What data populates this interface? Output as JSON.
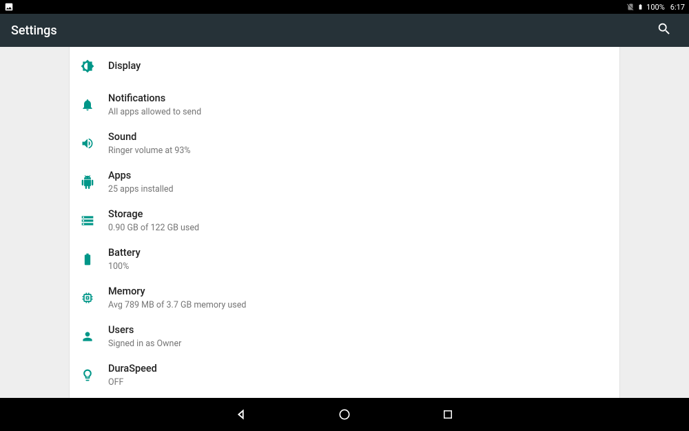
{
  "status": {
    "battery_text": "100%",
    "clock": "6:17"
  },
  "header": {
    "title": "Settings"
  },
  "items": [
    {
      "icon": "display",
      "title": "Display",
      "sub": null
    },
    {
      "icon": "notifications",
      "title": "Notifications",
      "sub": "All apps allowed to send"
    },
    {
      "icon": "sound",
      "title": "Sound",
      "sub": "Ringer volume at 93%"
    },
    {
      "icon": "apps",
      "title": "Apps",
      "sub": "25 apps installed"
    },
    {
      "icon": "storage",
      "title": "Storage",
      "sub": "0.90 GB of 122 GB used"
    },
    {
      "icon": "battery",
      "title": "Battery",
      "sub": "100%"
    },
    {
      "icon": "memory",
      "title": "Memory",
      "sub": "Avg 789 MB of 3.7 GB memory used"
    },
    {
      "icon": "users",
      "title": "Users",
      "sub": "Signed in as Owner"
    },
    {
      "icon": "duraspeed",
      "title": "DuraSpeed",
      "sub": "OFF"
    }
  ]
}
